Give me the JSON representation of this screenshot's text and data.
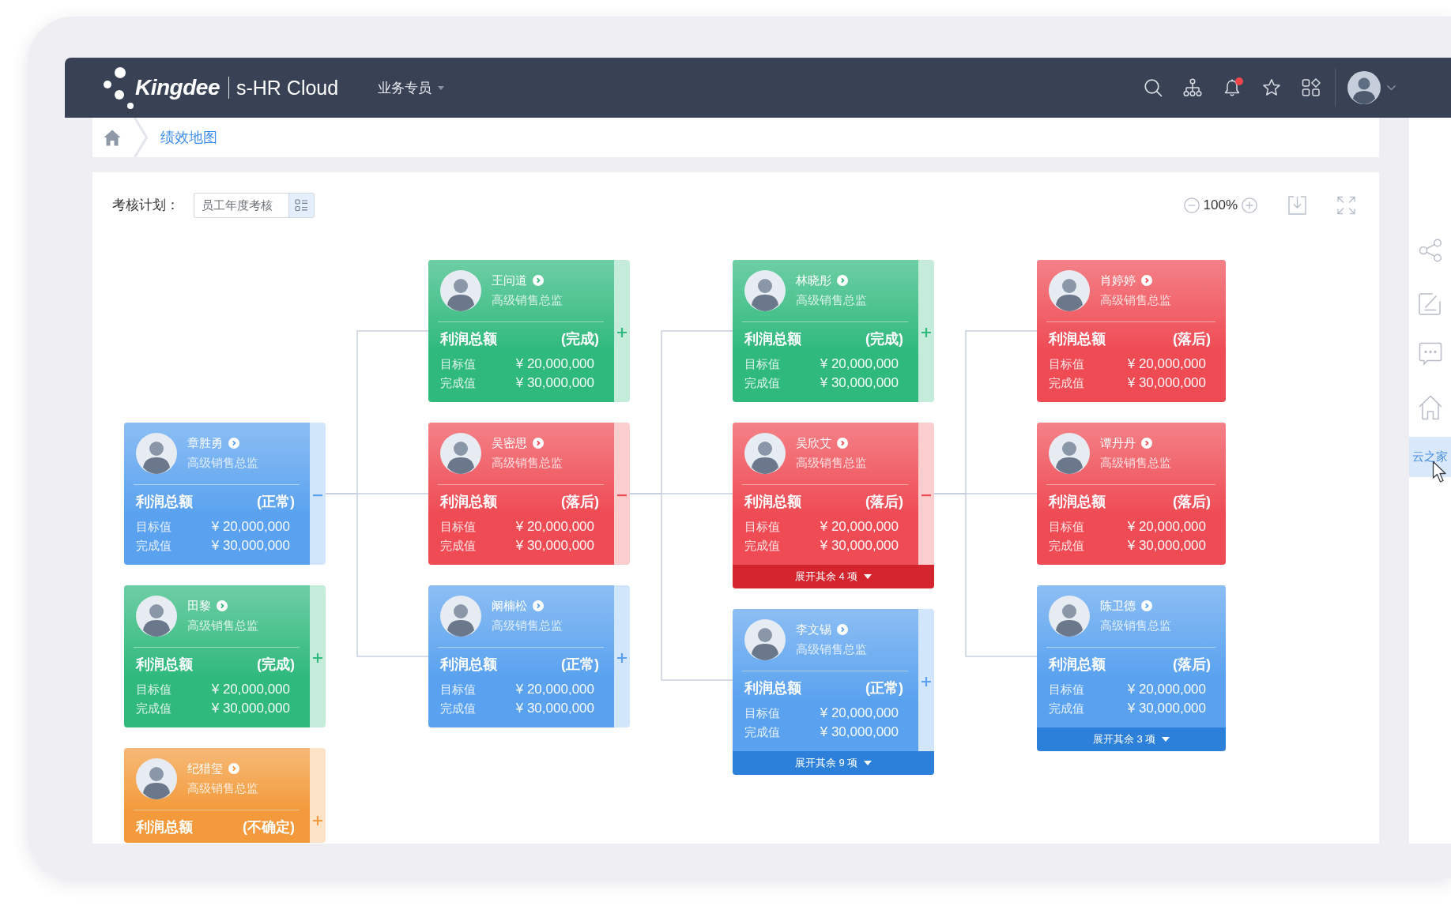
{
  "header": {
    "brand": "Kingdee",
    "product": "s-HR Cloud",
    "role_menu": "业务专员",
    "notifications_unread": true
  },
  "breadcrumb": {
    "current": "绩效地图"
  },
  "toolbar": {
    "plan_label": "考核计划：",
    "plan_value": "员工年度考核",
    "zoom_level": "100%"
  },
  "org_chart": {
    "nodes": [
      {
        "name": "章胜勇",
        "title": "高级销售总监",
        "color": "#5aa2ef",
        "metric": "利润总额",
        "status": "(正常)",
        "rows": [
          {
            "label": "目标值",
            "value": "¥ 20,000,000"
          },
          {
            "label": "完成值",
            "value": "¥ 30,000,000"
          }
        ],
        "expanded": true,
        "children": [
          {
            "name": "王问道",
            "title": "高级销售总监",
            "color": "#2fb97d",
            "metric": "利润总额",
            "status": "(完成)",
            "rows": [
              {
                "label": "目标值",
                "value": "¥ 20,000,000"
              },
              {
                "label": "完成值",
                "value": "¥ 30,000,000"
              }
            ],
            "expanded": false
          },
          {
            "name": "吴密思",
            "title": "高级销售总监",
            "color": "#ef4b54",
            "metric": "利润总额",
            "status": "(落后)",
            "rows": [
              {
                "label": "目标值",
                "value": "¥ 20,000,000"
              },
              {
                "label": "完成值",
                "value": "¥ 30,000,000"
              }
            ],
            "expanded": true,
            "children": [
              {
                "name": "林晓彤",
                "title": "高级销售总监",
                "color": "#2fb97d",
                "metric": "利润总额",
                "status": "(完成)",
                "rows": [
                  {
                    "label": "目标值",
                    "value": "¥ 20,000,000"
                  },
                  {
                    "label": "完成值",
                    "value": "¥ 30,000,000"
                  }
                ],
                "expanded": false
              },
              {
                "name": "吴欣艾",
                "title": "高级销售总监",
                "color": "#ef4b54",
                "metric": "利润总额",
                "status": "(落后)",
                "rows": [
                  {
                    "label": "目标值",
                    "value": "¥ 20,000,000"
                  },
                  {
                    "label": "完成值",
                    "value": "¥ 30,000,000"
                  }
                ],
                "expanded": true,
                "more": "展开其余 4 项",
                "children": [
                  {
                    "name": "肖婷婷",
                    "title": "高级销售总监",
                    "color": "#ef4b54",
                    "metric": "利润总额",
                    "status": "(落后)",
                    "rows": [
                      {
                        "label": "目标值",
                        "value": "¥ 20,000,000"
                      },
                      {
                        "label": "完成值",
                        "value": "¥ 30,000,000"
                      }
                    ]
                  },
                  {
                    "name": "谭丹丹",
                    "title": "高级销售总监",
                    "color": "#ef4b54",
                    "metric": "利润总额",
                    "status": "(落后)",
                    "rows": [
                      {
                        "label": "目标值",
                        "value": "¥ 20,000,000"
                      },
                      {
                        "label": "完成值",
                        "value": "¥ 30,000,000"
                      }
                    ]
                  },
                  {
                    "name": "陈卫德",
                    "title": "高级销售总监",
                    "color": "#5aa2ef",
                    "metric": "利润总额",
                    "status": "(落后)",
                    "rows": [
                      {
                        "label": "目标值",
                        "value": "¥ 20,000,000"
                      },
                      {
                        "label": "完成值",
                        "value": "¥ 30,000,000"
                      }
                    ],
                    "more": "展开其余 3 项"
                  }
                ]
              },
              {
                "name": "李文锡",
                "title": "高级销售总监",
                "color": "#5aa2ef",
                "metric": "利润总额",
                "status": "(正常)",
                "rows": [
                  {
                    "label": "目标值",
                    "value": "¥ 20,000,000"
                  },
                  {
                    "label": "完成值",
                    "value": "¥ 30,000,000"
                  }
                ],
                "expanded": false,
                "more": "展开其余 9 项"
              }
            ]
          },
          {
            "name": "阚楠松",
            "title": "高级销售总监",
            "color": "#5aa2ef",
            "metric": "利润总额",
            "status": "(正常)",
            "rows": [
              {
                "label": "目标值",
                "value": "¥ 20,000,000"
              },
              {
                "label": "完成值",
                "value": "¥ 30,000,000"
              }
            ],
            "expanded": false
          }
        ]
      },
      {
        "name": "田黎",
        "title": "高级销售总监",
        "color": "#2fb97d",
        "metric": "利润总额",
        "status": "(完成)",
        "rows": [
          {
            "label": "目标值",
            "value": "¥ 20,000,000"
          },
          {
            "label": "完成值",
            "value": "¥ 30,000,000"
          }
        ],
        "expanded": false
      },
      {
        "name": "纪猎玺",
        "title": "高级销售总监",
        "color": "#f39b3c",
        "metric": "利润总额",
        "status": "(不确定)",
        "expanded": false
      }
    ]
  },
  "side_toolbar": {
    "app_link": {
      "label": "云之家",
      "hovered": true
    }
  }
}
